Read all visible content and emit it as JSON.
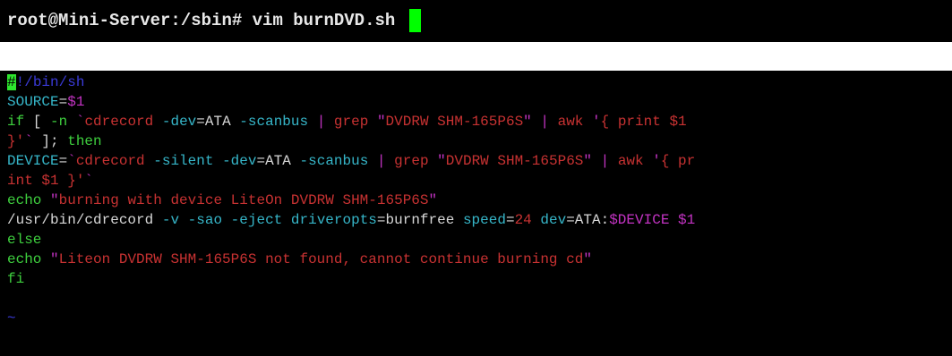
{
  "command_prompt": {
    "prompt": "root@Mini-Server:/sbin#",
    "command": "vim burnDVD.sh"
  },
  "editor": {
    "lines": [
      [
        {
          "t": "#",
          "c": "cursor-char"
        },
        {
          "t": "!/bin/sh",
          "c": "blue"
        }
      ],
      [
        {
          "t": "SOURCE",
          "c": "cyan"
        },
        {
          "t": "=",
          "c": "white"
        },
        {
          "t": "$1",
          "c": "magenta"
        }
      ],
      [
        {
          "t": "if",
          "c": "green"
        },
        {
          "t": " [ ",
          "c": "white"
        },
        {
          "t": "-n",
          "c": "green"
        },
        {
          "t": " ",
          "c": "white"
        },
        {
          "t": "`",
          "c": "magenta"
        },
        {
          "t": "cdrecord",
          "c": "red"
        },
        {
          "t": " ",
          "c": "white"
        },
        {
          "t": "-dev",
          "c": "cyan"
        },
        {
          "t": "=",
          "c": "white"
        },
        {
          "t": "ATA",
          "c": "white"
        },
        {
          "t": " ",
          "c": "white"
        },
        {
          "t": "-scanbus",
          "c": "cyan"
        },
        {
          "t": " | ",
          "c": "magenta"
        },
        {
          "t": "grep",
          "c": "red"
        },
        {
          "t": " ",
          "c": "white"
        },
        {
          "t": "\"",
          "c": "magenta"
        },
        {
          "t": "DVDRW SHM-165P6S",
          "c": "red"
        },
        {
          "t": "\"",
          "c": "magenta"
        },
        {
          "t": " | ",
          "c": "magenta"
        },
        {
          "t": "awk",
          "c": "red"
        },
        {
          "t": " ",
          "c": "white"
        },
        {
          "t": "'",
          "c": "magenta"
        },
        {
          "t": "{ print $1",
          "c": "red"
        }
      ],
      [
        {
          "t": "}'",
          "c": "red"
        },
        {
          "t": "`",
          "c": "magenta"
        },
        {
          "t": " ]; ",
          "c": "white"
        },
        {
          "t": "then",
          "c": "green"
        }
      ],
      [
        {
          "t": "DEVICE",
          "c": "cyan"
        },
        {
          "t": "=",
          "c": "white"
        },
        {
          "t": "`",
          "c": "magenta"
        },
        {
          "t": "cdrecord",
          "c": "red"
        },
        {
          "t": " ",
          "c": "white"
        },
        {
          "t": "-silent",
          "c": "cyan"
        },
        {
          "t": " ",
          "c": "white"
        },
        {
          "t": "-dev",
          "c": "cyan"
        },
        {
          "t": "=",
          "c": "white"
        },
        {
          "t": "ATA",
          "c": "white"
        },
        {
          "t": " ",
          "c": "white"
        },
        {
          "t": "-scanbus",
          "c": "cyan"
        },
        {
          "t": " | ",
          "c": "magenta"
        },
        {
          "t": "grep",
          "c": "red"
        },
        {
          "t": " ",
          "c": "white"
        },
        {
          "t": "\"",
          "c": "magenta"
        },
        {
          "t": "DVDRW SHM-165P6S",
          "c": "red"
        },
        {
          "t": "\"",
          "c": "magenta"
        },
        {
          "t": " | ",
          "c": "magenta"
        },
        {
          "t": "awk",
          "c": "red"
        },
        {
          "t": " ",
          "c": "white"
        },
        {
          "t": "'",
          "c": "magenta"
        },
        {
          "t": "{ pr",
          "c": "red"
        }
      ],
      [
        {
          "t": "int $1 }'",
          "c": "red"
        },
        {
          "t": "`",
          "c": "magenta"
        }
      ],
      [
        {
          "t": "echo",
          "c": "green"
        },
        {
          "t": " ",
          "c": "white"
        },
        {
          "t": "\"",
          "c": "magenta"
        },
        {
          "t": "burning with device LiteOn DVDRW SHM-165P6S",
          "c": "red"
        },
        {
          "t": "\"",
          "c": "magenta"
        }
      ],
      [
        {
          "t": "/usr/bin/cdrecord",
          "c": "white"
        },
        {
          "t": " ",
          "c": "white"
        },
        {
          "t": "-v",
          "c": "cyan"
        },
        {
          "t": " ",
          "c": "white"
        },
        {
          "t": "-sao",
          "c": "cyan"
        },
        {
          "t": " ",
          "c": "white"
        },
        {
          "t": "-eject",
          "c": "cyan"
        },
        {
          "t": " ",
          "c": "white"
        },
        {
          "t": "driveropts",
          "c": "cyan"
        },
        {
          "t": "=",
          "c": "white"
        },
        {
          "t": "burnfree",
          "c": "white"
        },
        {
          "t": " ",
          "c": "white"
        },
        {
          "t": "speed",
          "c": "cyan"
        },
        {
          "t": "=",
          "c": "white"
        },
        {
          "t": "24",
          "c": "red"
        },
        {
          "t": " ",
          "c": "white"
        },
        {
          "t": "dev",
          "c": "cyan"
        },
        {
          "t": "=",
          "c": "white"
        },
        {
          "t": "ATA:",
          "c": "white"
        },
        {
          "t": "$DEVICE",
          "c": "magenta"
        },
        {
          "t": " ",
          "c": "white"
        },
        {
          "t": "$1",
          "c": "magenta"
        }
      ],
      [
        {
          "t": "else",
          "c": "green"
        }
      ],
      [
        {
          "t": "echo",
          "c": "green"
        },
        {
          "t": " ",
          "c": "white"
        },
        {
          "t": "\"",
          "c": "magenta"
        },
        {
          "t": "Liteon DVDRW SHM-165P6S not found, cannot continue burning cd",
          "c": "red"
        },
        {
          "t": "\"",
          "c": "magenta"
        }
      ],
      [
        {
          "t": "fi",
          "c": "green"
        }
      ],
      [],
      [
        {
          "t": "~",
          "c": "blue"
        }
      ]
    ]
  }
}
